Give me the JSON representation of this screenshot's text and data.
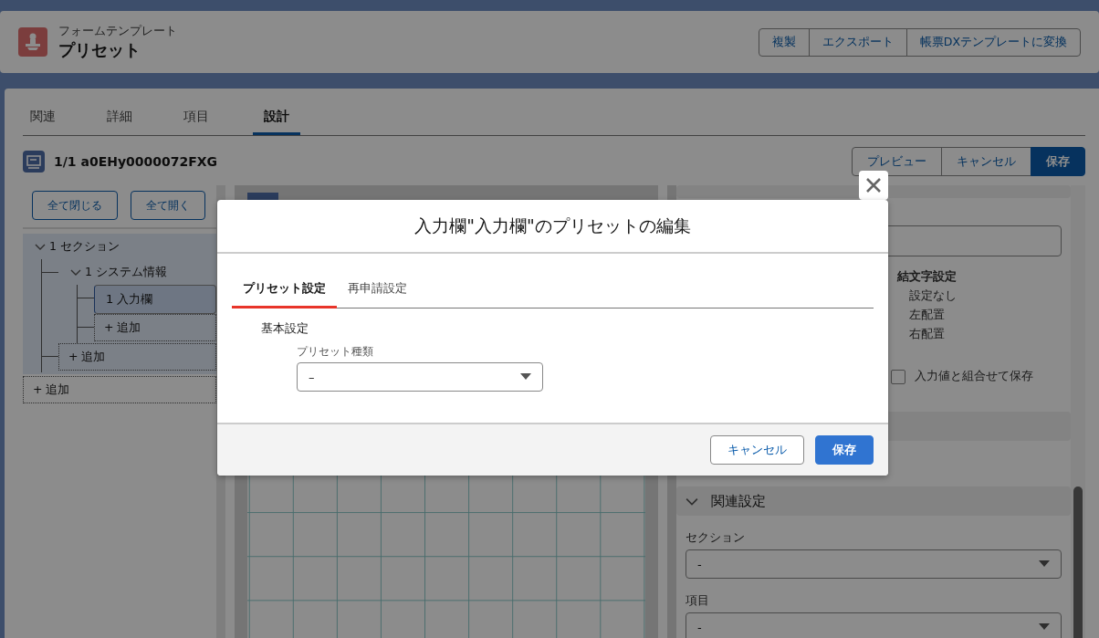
{
  "header": {
    "object_type": "フォームテンプレート",
    "title": "プリセット",
    "actions": [
      "複製",
      "エクスポート",
      "帳票DXテンプレートに変換"
    ]
  },
  "tabs": [
    {
      "label": "関連",
      "selected": false
    },
    {
      "label": "詳細",
      "selected": false
    },
    {
      "label": "項目",
      "selected": false
    },
    {
      "label": "設計",
      "selected": true
    }
  ],
  "record": {
    "title": "1/1 a0EHy0000072FXG"
  },
  "toolbar_buttons": [
    {
      "label": "プレビュー",
      "kind": "neutral"
    },
    {
      "label": "キャンセル",
      "kind": "neutral"
    },
    {
      "label": "保存",
      "kind": "brand"
    }
  ],
  "tree": {
    "buttons": [
      "全て閉じる",
      "全て開く"
    ],
    "nodes": [
      {
        "kind": "node",
        "label": "1 セクション",
        "expanded": true,
        "selected": false,
        "children": [
          {
            "kind": "node",
            "label": "1 システム情報",
            "expanded": true,
            "selected": false,
            "children": [
              {
                "kind": "node",
                "label": "1 入力欄",
                "selected": true
              },
              {
                "kind": "add",
                "label": "+ 追加"
              }
            ]
          },
          {
            "kind": "add",
            "label": "+ 追加"
          }
        ]
      },
      {
        "kind": "add",
        "label": "+ 追加"
      }
    ]
  },
  "properties": {
    "connector_heading": "結文字設定",
    "options": [
      "設定なし",
      "左配置",
      "右配置"
    ],
    "checkbox": {
      "label": "入力値と組合せて保存",
      "checked": false
    },
    "section": {
      "title": "関連設定",
      "expanded": true
    },
    "fields": [
      {
        "label": "セクション",
        "value": "-"
      },
      {
        "label": "項目",
        "value": "-"
      }
    ]
  },
  "modal": {
    "title": "入力欄\"入力欄\"のプリセットの編集",
    "tabs": [
      {
        "label": "プリセット設定",
        "selected": true
      },
      {
        "label": "再申請設定",
        "selected": false
      }
    ],
    "section_title": "基本設定",
    "field": {
      "label": "プリセット種類",
      "value": "–"
    },
    "buttons": [
      {
        "label": "キャンセル",
        "kind": "neutral"
      },
      {
        "label": "保存",
        "kind": "brand"
      }
    ]
  }
}
